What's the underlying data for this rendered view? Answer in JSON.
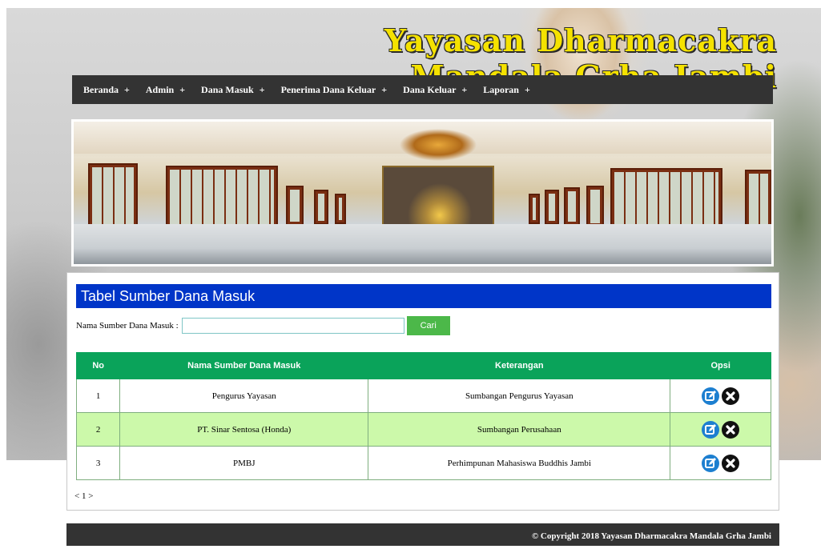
{
  "site": {
    "title": "Yayasan Dharmacakra Mandala Grha Jambi"
  },
  "nav": {
    "items": [
      {
        "label": "Beranda",
        "plus": "+"
      },
      {
        "label": "Admin",
        "plus": "+"
      },
      {
        "label": "Dana Masuk",
        "plus": "+"
      },
      {
        "label": "Penerima Dana Keluar",
        "plus": "+"
      },
      {
        "label": "Dana Keluar",
        "plus": "+"
      },
      {
        "label": "Laporan",
        "plus": "+"
      }
    ]
  },
  "page": {
    "title": "Tabel Sumber Dana Masuk"
  },
  "search": {
    "label": "Nama Sumber Dana Masuk :",
    "value": "",
    "button": "Cari"
  },
  "table": {
    "headers": [
      "No",
      "Nama Sumber Dana Masuk",
      "Keterangan",
      "Opsi"
    ],
    "rows": [
      {
        "no": "1",
        "nama": "Pengurus Yayasan",
        "keterangan": "Sumbangan Pengurus Yayasan"
      },
      {
        "no": "2",
        "nama": "PT. Sinar Sentosa (Honda)",
        "keterangan": "Sumbangan Perusahaan"
      },
      {
        "no": "3",
        "nama": "PMBJ",
        "keterangan": "Perhimpunan Mahasiswa Buddhis Jambi"
      }
    ],
    "actions": {
      "edit_icon": "edit-icon",
      "delete_icon": "delete-icon"
    }
  },
  "pagination": {
    "prev": "<",
    "current": "1",
    "next": ">"
  },
  "footer": {
    "text": "© Copyright 2018 Yayasan Dharmacakra Mandala Grha Jambi"
  },
  "colors": {
    "nav_bg": "#333333",
    "title_bar": "#0035c8",
    "table_header": "#0aa35a",
    "row_alt": "#ccf9aa",
    "search_button": "#4cb849",
    "edit_icon": "#1d7fd0",
    "header_text": "#f5e200"
  }
}
